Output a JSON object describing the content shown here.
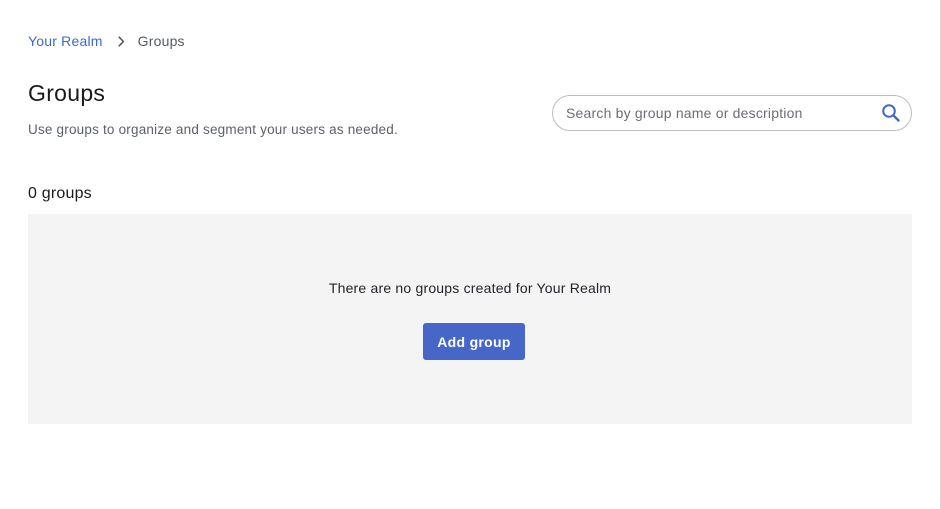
{
  "breadcrumb": {
    "realm_label": "Your Realm",
    "current_label": "Groups"
  },
  "header": {
    "title": "Groups",
    "description": "Use groups to organize and segment your users as needed."
  },
  "search": {
    "placeholder": "Search by group name or description",
    "value": ""
  },
  "list": {
    "count_label": "0 groups"
  },
  "empty_state": {
    "message": "There are no groups created for Your Realm",
    "add_button_label": "Add group"
  },
  "colors": {
    "accent": "#4666c8",
    "link": "#3f68c9",
    "empty_bg": "#f4f4f4"
  },
  "icons": {
    "breadcrumb_separator": "chevron-right-icon",
    "search": "search-icon"
  }
}
